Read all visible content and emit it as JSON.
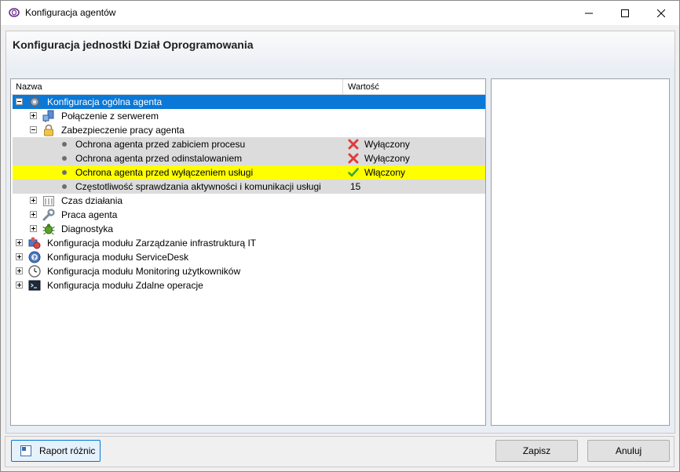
{
  "window": {
    "title": "Konfiguracja agentów"
  },
  "header": {
    "title": "Konfiguracja jednostki Dział Oprogramowania"
  },
  "tree": {
    "columns": {
      "name": "Nazwa",
      "value": "Wartość"
    },
    "rows": [
      {
        "label": "Konfiguracja ogólna agenta",
        "value": "",
        "icon": "gear-icon",
        "state": "expanded",
        "highlight": "selected"
      },
      {
        "label": "Połączenie z serwerem",
        "value": "",
        "icon": "network-icon",
        "state": "collapsed",
        "highlight": "none"
      },
      {
        "label": "Zabezpieczenie pracy agenta",
        "value": "",
        "icon": "lock-icon",
        "state": "expanded",
        "highlight": "none"
      },
      {
        "label": "Ochrona agenta przed zabiciem procesu",
        "value": "Wyłączony",
        "icon": "bullet",
        "status_icon": "red-x-icon",
        "highlight": "grey"
      },
      {
        "label": "Ochrona agenta przed odinstalowaniem",
        "value": "Wyłączony",
        "icon": "bullet",
        "status_icon": "red-x-icon",
        "highlight": "grey"
      },
      {
        "label": "Ochrona agenta przed wyłączeniem usługi",
        "value": "Włączony",
        "icon": "bullet",
        "status_icon": "green-check-icon",
        "highlight": "yellow"
      },
      {
        "label": "Częstotliwość sprawdzania aktywności i komunikacji usługi",
        "value": "15",
        "icon": "bullet",
        "highlight": "grey"
      },
      {
        "label": "Czas działania",
        "value": "",
        "icon": "calendar-icon",
        "state": "collapsed",
        "highlight": "none"
      },
      {
        "label": "Praca agenta",
        "value": "",
        "icon": "wrench-icon",
        "state": "collapsed",
        "highlight": "none"
      },
      {
        "label": "Diagnostyka",
        "value": "",
        "icon": "bug-icon",
        "state": "collapsed",
        "highlight": "none"
      },
      {
        "label": "Konfiguracja modułu Zarządzanie infrastrukturą IT",
        "value": "",
        "icon": "infrastructure-icon",
        "state": "collapsed",
        "highlight": "none"
      },
      {
        "label": "Konfiguracja modułu ServiceDesk",
        "value": "",
        "icon": "help-icon",
        "state": "collapsed",
        "highlight": "none"
      },
      {
        "label": "Konfiguracja modułu Monitoring użytkowników",
        "value": "",
        "icon": "clock-icon",
        "state": "collapsed",
        "highlight": "none"
      },
      {
        "label": "Konfiguracja modułu Zdalne operacje",
        "value": "",
        "icon": "terminal-icon",
        "state": "collapsed",
        "highlight": "none"
      }
    ]
  },
  "buttons": {
    "report": "Raport różnic",
    "save": "Zapisz",
    "cancel": "Anuluj"
  },
  "colors": {
    "selection": "#0a78d7",
    "highlight_yellow": "#ffff00",
    "highlight_grey": "#dcdcdc"
  }
}
